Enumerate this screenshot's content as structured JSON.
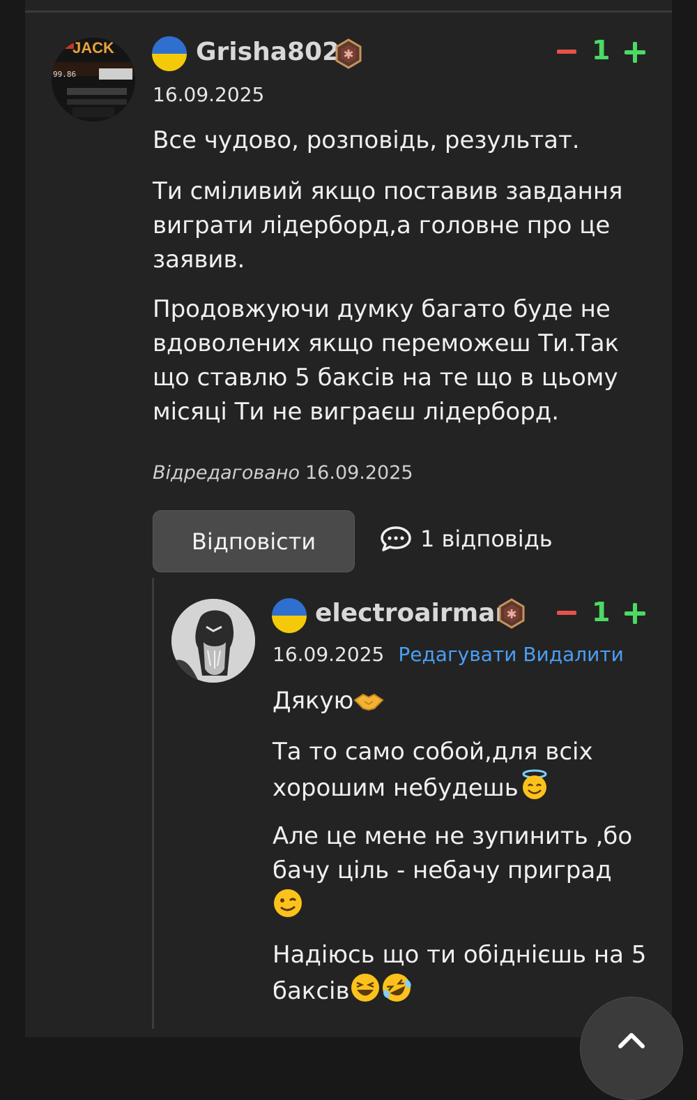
{
  "comment": {
    "username": "Grisha802",
    "date": "16.09.2025",
    "votes": "1",
    "paragraphs": [
      "Все чудово, розповідь, результат.",
      "Ти сміливий якщо поставив завдання виграти лідерборд,а головне про це заявив.",
      "Продовжуючи думку багато буде не вдоволених якщо переможеш Ти.Так що ставлю 5 баксів на те що в цьому місяці Ти не виграєш лідерборд."
    ],
    "edited_label": "Відредаговано",
    "edited_date": "16.09.2025",
    "reply_button": "Відповісти",
    "replies_count": "1 відповідь"
  },
  "reply": {
    "username": "electroairman",
    "date": "16.09.2025",
    "votes": "1",
    "edit_link": "Редагувати",
    "delete_link": "Видалити",
    "paragraphs": [
      "Дякую",
      "Та то само собой,для всіх хорошим небудешь",
      "Але це мене не зупинить ,бо бачу ціль - небачу приград",
      "Надіюсь що ти обіднієшь на 5 баксів"
    ]
  },
  "icons": {
    "flag": "ukraine-flag-icon",
    "badge": "rank-badge-icon",
    "replies": "speech-bubble-icon",
    "scroll": "arrow-up-icon"
  },
  "colors": {
    "accent_link": "#4a9ff5",
    "vote_plus": "#4cd964",
    "vote_minus": "#e5534b"
  }
}
